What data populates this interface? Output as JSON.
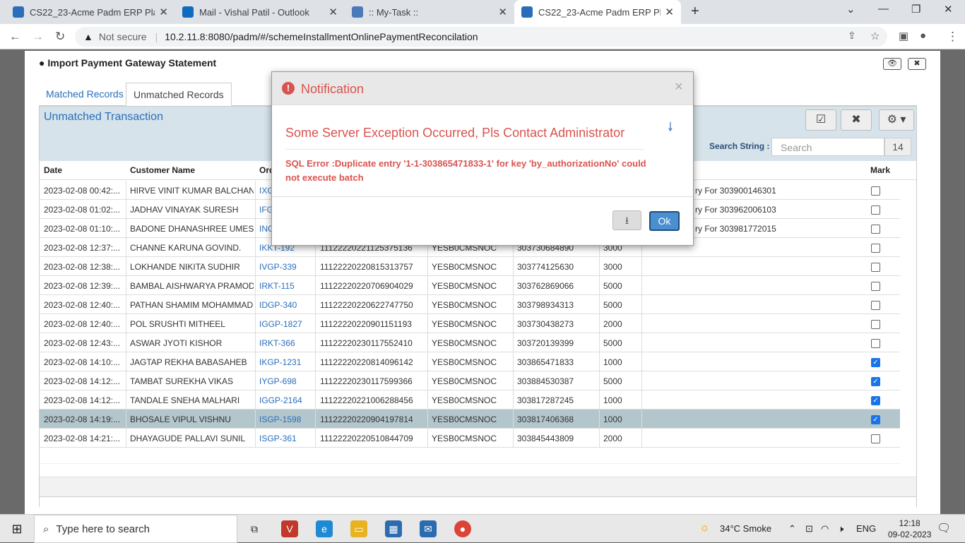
{
  "browser": {
    "tabs": [
      {
        "title": "CS22_23-Acme Padm ERP Platfor",
        "color": "#2a6ebb"
      },
      {
        "title": "Mail - Vishal Patil - Outlook",
        "color": "#0f6cbd"
      },
      {
        "title": ":: My-Task ::",
        "color": "#4a7ab8"
      },
      {
        "title": "CS22_23-Acme Padm ERP Platfor",
        "color": "#2a6ebb"
      }
    ],
    "not_secure": "Not secure",
    "url": "10.2.11.8:8080/padm/#/schemeInstallmentOnlinePaymentReconcilation"
  },
  "modal": {
    "title": "Import Payment Gateway Statement",
    "tabs": [
      "Matched Records",
      "Unmatched Records"
    ],
    "panel_title": "Unmatched Transaction",
    "search_label": "Search String :",
    "search_placeholder": "Search",
    "search_count": "14",
    "columns": [
      "Date",
      "Customer Name",
      "Ord",
      "Mark"
    ],
    "rows": [
      {
        "date": "2023-02-08 00:42:...",
        "name": "HIRVE VINIT KUMAR BALCHAN",
        "order": "IXG",
        "txn": "",
        "bank": "",
        "ref": "",
        "amount": "",
        "remark": "ry For 303900146301",
        "mark": false
      },
      {
        "date": "2023-02-08 01:02:...",
        "name": "JADHAV VINAYAK SURESH",
        "order": "IFG",
        "txn": "",
        "bank": "",
        "ref": "",
        "amount": "",
        "remark": "ry For 303962006103",
        "mark": false
      },
      {
        "date": "2023-02-08 01:10:...",
        "name": "BADONE DHANASHREE UMES",
        "order": "INC",
        "txn": "",
        "bank": "",
        "ref": "",
        "amount": "",
        "remark": "ry For 303981772015",
        "mark": false
      },
      {
        "date": "2023-02-08 12:37:...",
        "name": "CHANNE KARUNA GOVIND.",
        "order": "IKKT-192",
        "txn": "11122220221125375136",
        "bank": "YESB0CMSNOC",
        "ref": "303730684890",
        "amount": "3000",
        "remark": "",
        "mark": false
      },
      {
        "date": "2023-02-08 12:38:...",
        "name": "LOKHANDE NIKITA SUDHIR",
        "order": "IVGP-339",
        "txn": "11122220220815313757",
        "bank": "YESB0CMSNOC",
        "ref": "303774125630",
        "amount": "3000",
        "remark": "",
        "mark": false
      },
      {
        "date": "2023-02-08 12:39:...",
        "name": "BAMBAL AISHWARYA PRAMOD",
        "order": "IRKT-115",
        "txn": "11122220220706904029",
        "bank": "YESB0CMSNOC",
        "ref": "303762869066",
        "amount": "5000",
        "remark": "",
        "mark": false
      },
      {
        "date": "2023-02-08 12:40:...",
        "name": "PATHAN SHAMIM MOHAMMAD",
        "order": "IDGP-340",
        "txn": "11122220220622747750",
        "bank": "YESB0CMSNOC",
        "ref": "303798934313",
        "amount": "5000",
        "remark": "",
        "mark": false
      },
      {
        "date": "2023-02-08 12:40:...",
        "name": "POL SRUSHTI MITHEEL",
        "order": "IGGP-1827",
        "txn": "11122220220901151193",
        "bank": "YESB0CMSNOC",
        "ref": "303730438273",
        "amount": "2000",
        "remark": "",
        "mark": false
      },
      {
        "date": "2023-02-08 12:43:...",
        "name": "ASWAR JYOTI KISHOR",
        "order": "IRKT-366",
        "txn": "11122220230117552410",
        "bank": "YESB0CMSNOC",
        "ref": "303720139399",
        "amount": "5000",
        "remark": "",
        "mark": false
      },
      {
        "date": "2023-02-08 14:10:...",
        "name": "JAGTAP REKHA BABASAHEB",
        "order": "IKGP-1231",
        "txn": "11122220220814096142",
        "bank": "YESB0CMSNOC",
        "ref": "303865471833",
        "amount": "1000",
        "remark": "",
        "mark": true
      },
      {
        "date": "2023-02-08 14:12:...",
        "name": "TAMBAT SUREKHA VIKAS",
        "order": "IYGP-698",
        "txn": "11122220230117599366",
        "bank": "YESB0CMSNOC",
        "ref": "303884530387",
        "amount": "5000",
        "remark": "",
        "mark": true
      },
      {
        "date": "2023-02-08 14:12:...",
        "name": "TANDALE SNEHA MALHARI",
        "order": "IGGP-2164",
        "txn": "11122220221006288456",
        "bank": "YESB0CMSNOC",
        "ref": "303817287245",
        "amount": "1000",
        "remark": "",
        "mark": true
      },
      {
        "date": "2023-02-08 14:19:...",
        "name": "BHOSALE VIPUL VISHNU",
        "order": "ISGP-1598",
        "txn": "11122220220904197814",
        "bank": "YESB0CMSNOC",
        "ref": "303817406368",
        "amount": "1000",
        "remark": "",
        "mark": true,
        "highlight": true
      },
      {
        "date": "2023-02-08 14:21:...",
        "name": "DHAYAGUDE PALLAVI SUNIL",
        "order": "ISGP-361",
        "txn": "11122220220510844709",
        "bank": "YESB0CMSNOC",
        "ref": "303845443809",
        "amount": "2000",
        "remark": "",
        "mark": false
      }
    ]
  },
  "notification": {
    "title": "Notification",
    "message": "Some Server Exception Occurred, Pls Contact Administrator",
    "error": "SQL Error :Duplicate entry '1-1-303865471833-1' for key 'by_authorizationNo' could not execute batch",
    "ok_label": "Ok"
  },
  "taskbar": {
    "search_placeholder": "Type here to search",
    "weather": "34°C  Smoke",
    "lang": "ENG",
    "time": "12:18",
    "date": "09-02-2023"
  }
}
